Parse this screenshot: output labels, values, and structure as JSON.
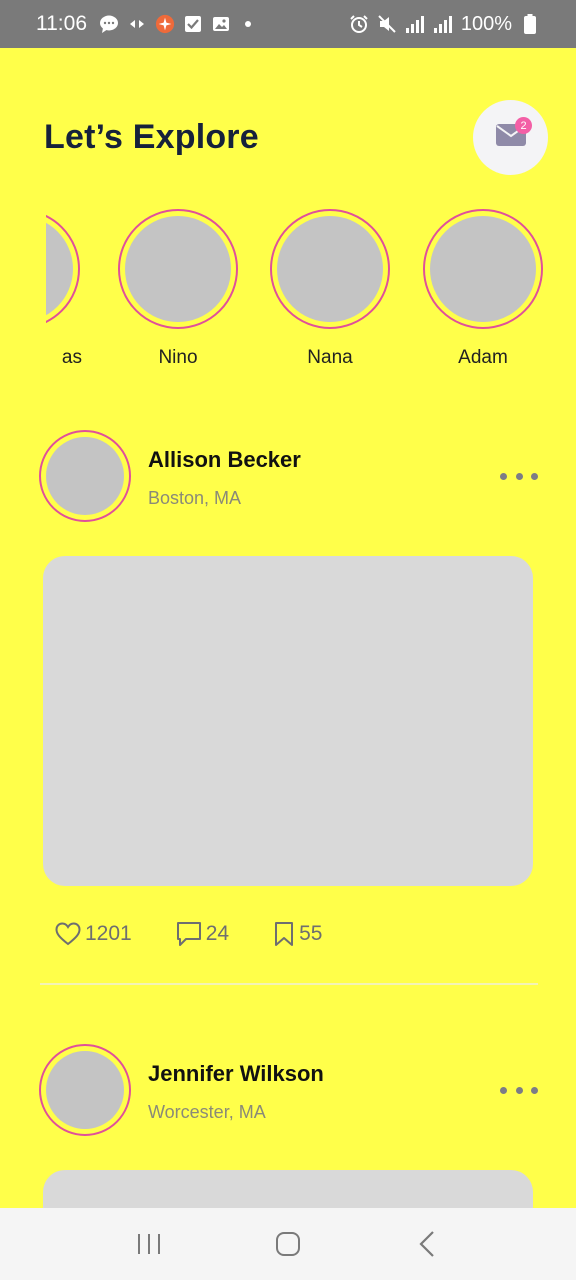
{
  "status_bar": {
    "time": "11:06",
    "battery": "100%",
    "left_icons": [
      "chat-bubble-icon",
      "sync-arrows-icon",
      "app-notification-icon",
      "checkbox-icon",
      "gallery-icon"
    ],
    "right_icons": [
      "alarm-icon",
      "mute-icon",
      "signal-icon",
      "signal-icon",
      "battery-icon"
    ]
  },
  "header": {
    "title": "Let’s Explore",
    "mail_badge": "2"
  },
  "stories": [
    {
      "name": "as"
    },
    {
      "name": "Nino"
    },
    {
      "name": "Nana"
    },
    {
      "name": "Adam"
    }
  ],
  "posts": [
    {
      "name": "Allison Becker",
      "location": "Boston, MA",
      "likes": "1201",
      "comments": "24",
      "saves": "55"
    },
    {
      "name": "Jennifer Wilkson",
      "location": "Worcester, MA"
    }
  ],
  "colors": {
    "background": "#ffff4a",
    "title": "#16213b",
    "ring": "#e0509a",
    "badge": "#f35fa6",
    "placeholder": "#c4c4c4"
  }
}
